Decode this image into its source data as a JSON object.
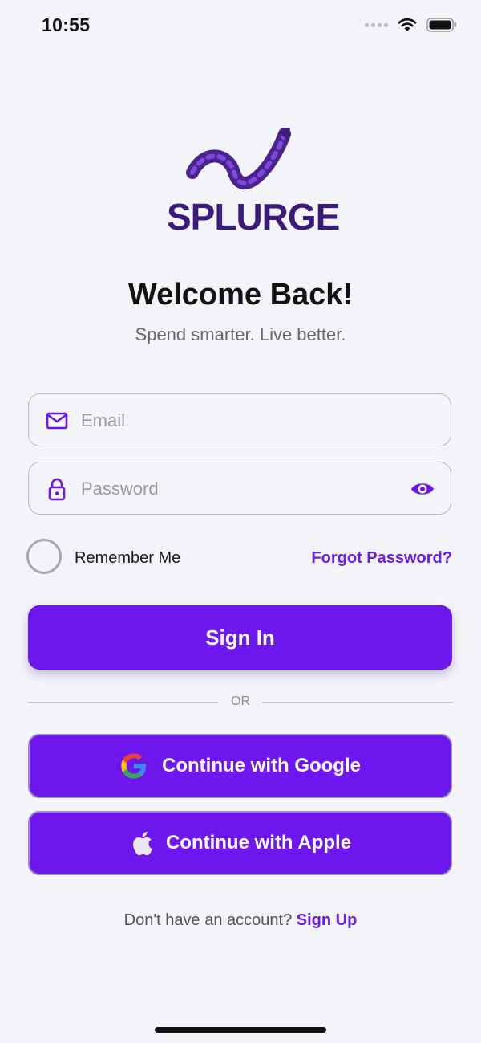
{
  "status_bar": {
    "time": "10:55"
  },
  "brand": {
    "logo_text": "SPLURGE"
  },
  "header": {
    "title": "Welcome Back!",
    "subtitle": "Spend smarter. Live better."
  },
  "form": {
    "email": {
      "placeholder": "Email",
      "value": ""
    },
    "password": {
      "placeholder": "Password",
      "value": ""
    },
    "remember_label": "Remember Me",
    "remember_checked": false,
    "forgot_label": "Forgot Password?",
    "signin_label": "Sign In"
  },
  "divider": {
    "label": "OR"
  },
  "social": {
    "google_label": "Continue with Google",
    "apple_label": "Continue with Apple"
  },
  "footer": {
    "prompt": "Don't have an account?",
    "signup_label": "Sign Up"
  },
  "colors": {
    "accent": "#6d16ee",
    "background": "#f3f4f8",
    "logo": "#3a1a7a"
  },
  "icons": [
    "mail-icon",
    "lock-icon",
    "eye-icon",
    "google-icon",
    "apple-icon",
    "wifi-icon",
    "battery-icon"
  ]
}
